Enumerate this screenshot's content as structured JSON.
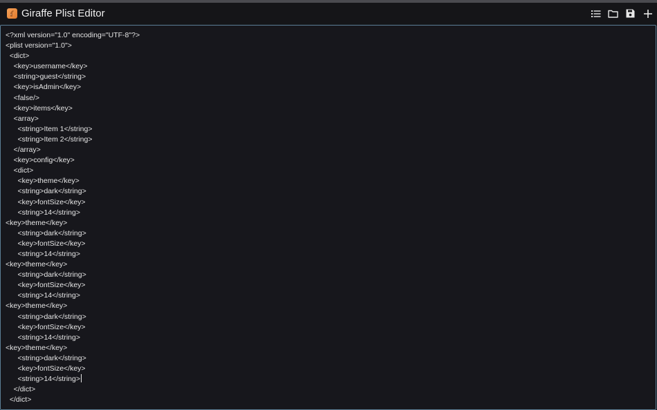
{
  "window": {
    "title": "Giraffe Plist Editor"
  },
  "toolbar": {
    "icons": [
      "list-icon",
      "folder-icon",
      "save-icon",
      "add-icon"
    ]
  },
  "colors": {
    "background": "#141417",
    "editor_border": "#5c7f96",
    "text": "#e6e6e6",
    "app_icon": "#e0792c"
  },
  "editor": {
    "lines": [
      "<?xml version=\"1.0\" encoding=\"UTF-8\"?>",
      "<plist version=\"1.0\">",
      "  <dict>",
      "    <key>username</key>",
      "    <string>guest</string>",
      "    <key>isAdmin</key>",
      "    <false/>",
      "    <key>items</key>",
      "    <array>",
      "      <string>Item 1</string>",
      "      <string>Item 2</string>",
      "    </array>",
      "    <key>config</key>",
      "    <dict>",
      "      <key>theme</key>",
      "      <string>dark</string>",
      "      <key>fontSize</key>",
      "      <string>14</string>",
      "<key>theme</key>",
      "      <string>dark</string>",
      "      <key>fontSize</key>",
      "      <string>14</string>",
      "<key>theme</key>",
      "      <string>dark</string>",
      "      <key>fontSize</key>",
      "      <string>14</string>",
      "<key>theme</key>",
      "      <string>dark</string>",
      "      <key>fontSize</key>",
      "      <string>14</string>",
      "<key>theme</key>",
      "      <string>dark</string>",
      "      <key>fontSize</key>",
      "      <string>14</string>",
      "    </dict>",
      "  </dict>"
    ],
    "caret_line": 33
  }
}
